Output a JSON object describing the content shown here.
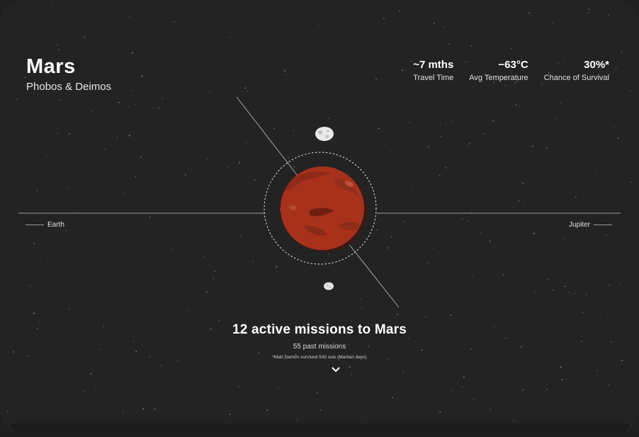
{
  "planet": {
    "name": "Mars",
    "moons_label": "Phobos & Deimos"
  },
  "stats": [
    {
      "value": "~7 mths",
      "label": "Travel Time"
    },
    {
      "value": "−63°C",
      "label": "Avg Temperature"
    },
    {
      "value": "30%*",
      "label": "Chance of Survival"
    }
  ],
  "orbit": {
    "left_label": "Earth",
    "right_label": "Jupiter"
  },
  "missions": {
    "title": "12 active missions to Mars",
    "past": "55 past missions",
    "footnote": "*Matt Damon survived 543 sols (Martian days)"
  },
  "colors": {
    "background": "#232323",
    "mars": "#a8311b",
    "moon": "#e8e8e8",
    "text": "#ffffff"
  },
  "icons": {
    "scroll": "chevron-down-icon"
  }
}
